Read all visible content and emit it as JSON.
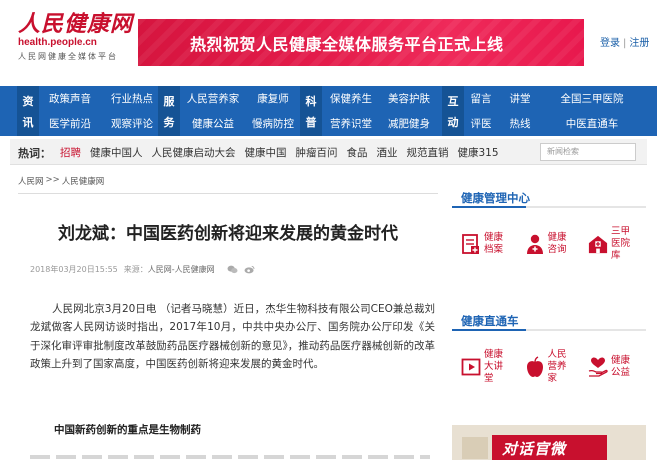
{
  "header": {
    "logo_main": "人民健康网",
    "logo_url": "health.people.cn",
    "logo_sub": "人民网健康全媒体平台",
    "banner_text": "热烈祝贺人民健康全媒体服务平台正式上线",
    "login": "登录",
    "register": "注册",
    "separator": "|"
  },
  "nav": {
    "blocks": [
      {
        "category": [
          "资",
          "讯"
        ],
        "items": [
          "政策声音",
          "医学前沿",
          "行业热点",
          "观察评论"
        ]
      },
      {
        "category": [
          "服",
          "务"
        ],
        "items": [
          "人民营养家",
          "健康公益",
          "康复师",
          "慢病防控"
        ]
      },
      {
        "category": [
          "科",
          "普"
        ],
        "items": [
          "保健养生",
          "营养识堂",
          "美容护肤",
          "减肥健身"
        ]
      },
      {
        "category": [
          "互",
          "动"
        ],
        "items": [
          "留言",
          "评医"
        ]
      },
      {
        "category": [],
        "items": [
          "讲堂",
          "热线",
          "全国三甲医院",
          "中医直通车"
        ]
      }
    ]
  },
  "hotbar": {
    "label": "热词：",
    "items": [
      "招聘",
      "健康中国人",
      "人民健康启动大会",
      "健康中国",
      "肿瘤百问",
      "食品",
      "酒业",
      "规范直销",
      "健康315"
    ],
    "search_placeholder": "新闻检索"
  },
  "article": {
    "breadcrumb": [
      "人民网",
      ">>",
      "人民健康网"
    ],
    "title": "刘龙斌：中国医药创新将迎来发展的黄金时代",
    "date": "2018年03月20日15:55",
    "source_label": "来源：",
    "source": "人民网-人民健康网",
    "body": "人民网北京3月20日电 （记者马晓慧）近日，杰华生物科技有限公司CEO兼总裁刘龙斌做客人民网访谈时指出，2017年10月，中共中央办公厅、国务院办公厅印发《关于深化审评审批制度改革鼓励药品医疗器械创新的意见》，推动药品医疗器械创新的改革政策上升到了国家高度，中国医药创新将迎来发展的黄金时代。",
    "subhead": "中国新药创新的重点是生物制药"
  },
  "sidebar": {
    "management": {
      "title": "健康管理中心",
      "items": [
        {
          "label": "健康档案",
          "icon": "health-file-icon"
        },
        {
          "label": "健康咨询",
          "icon": "doctor-icon"
        },
        {
          "label": "三甲医院库",
          "icon": "hospital-icon"
        }
      ]
    },
    "express": {
      "title": "健康直通车",
      "items": [
        {
          "label": "健康大讲堂",
          "icon": "video-play-icon"
        },
        {
          "label": "人民营养家",
          "icon": "apple-icon"
        },
        {
          "label": "健康公益",
          "icon": "heart-hand-icon"
        }
      ]
    },
    "promo_text": "对话官微"
  },
  "colors": {
    "brand_red": "#c8102e",
    "nav_blue": "#1e64b4",
    "nav_dark_blue": "#155395"
  }
}
